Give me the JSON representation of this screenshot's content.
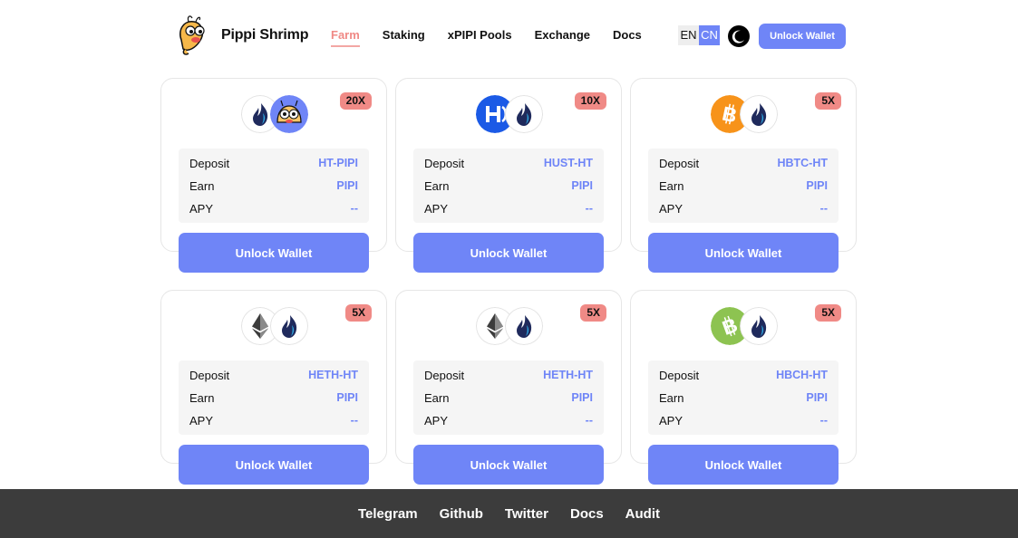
{
  "header": {
    "logo_text": "Pippi Shrimp",
    "nav": [
      "Farm",
      "Staking",
      "xPIPI Pools",
      "Exchange",
      "Docs"
    ],
    "active_nav": "Farm",
    "lang_en": "EN",
    "lang_cn": "CN",
    "theme_icon": "moon-icon",
    "unlock_label": "Unlock Wallet"
  },
  "labels": {
    "deposit": "Deposit",
    "earn": "Earn",
    "apy": "APY"
  },
  "farms": [
    {
      "multiplier": "20X",
      "deposit": "HT-PIPI",
      "earn": "PIPI",
      "apy": "--",
      "button": "Unlock Wallet",
      "icons": [
        "huobi-token-icon",
        "pippi-shrimp-icon"
      ]
    },
    {
      "multiplier": "10X",
      "deposit": "HUST-HT",
      "earn": "PIPI",
      "apy": "--",
      "button": "Unlock Wallet",
      "icons": [
        "husd-icon",
        "huobi-token-icon"
      ]
    },
    {
      "multiplier": "5X",
      "deposit": "HBTC-HT",
      "earn": "PIPI",
      "apy": "--",
      "button": "Unlock Wallet",
      "icons": [
        "bitcoin-icon",
        "huobi-token-icon"
      ]
    },
    {
      "multiplier": "5X",
      "deposit": "HETH-HT",
      "earn": "PIPI",
      "apy": "--",
      "button": "Unlock Wallet",
      "icons": [
        "ethereum-icon",
        "huobi-token-icon"
      ]
    },
    {
      "multiplier": "5X",
      "deposit": "HETH-HT",
      "earn": "PIPI",
      "apy": "--",
      "button": "Unlock Wallet",
      "icons": [
        "ethereum-icon",
        "huobi-token-icon"
      ]
    },
    {
      "multiplier": "5X",
      "deposit": "HBCH-HT",
      "earn": "PIPI",
      "apy": "--",
      "button": "Unlock Wallet",
      "icons": [
        "bitcoin-cash-icon",
        "huobi-token-icon"
      ]
    }
  ],
  "footer": [
    "Telegram",
    "Github",
    "Twitter",
    "Docs",
    "Audit"
  ],
  "colors": {
    "accent": "#6f85f7",
    "badge": "#f08a86",
    "footer": "#3c3c3c"
  }
}
